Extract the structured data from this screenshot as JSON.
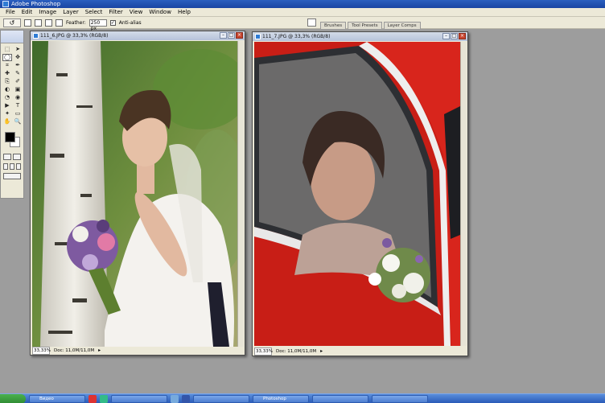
{
  "app": {
    "title": "Adobe Photoshop"
  },
  "menu": [
    "File",
    "Edit",
    "Image",
    "Layer",
    "Select",
    "Filter",
    "View",
    "Window",
    "Help"
  ],
  "options": {
    "feather_label": "Feather:",
    "feather_value": "250 px",
    "antialias_label": "Anti-alias",
    "antialias_checked": "✓"
  },
  "palette_tabs": [
    "Brushes",
    "Tool Presets",
    "Layer Comps"
  ],
  "tools": [
    "⬚",
    "➤",
    "◯",
    "✥",
    "⌗",
    "✒",
    "✚",
    "✎",
    "⎘",
    "✐",
    "◐",
    "▣",
    "◔",
    "◉",
    "▶",
    "T",
    "✦",
    "▭",
    "✋",
    "🔍"
  ],
  "documents": [
    {
      "title": "111_6.JPG @ 33,3% (RGB/8)",
      "zoom": "33,33%",
      "doc": "Doc: 11,0M/11,0M"
    },
    {
      "title": "111_7.JPG @ 33,3% (RGB/8)",
      "zoom": "33,33%",
      "doc": "Doc: 11,0M/11,0M"
    }
  ],
  "window_buttons": {
    "minimize": "–",
    "maximize": "□",
    "close": "×"
  },
  "taskbar": {
    "items": [
      "Видео",
      "",
      "Photoshop",
      "",
      "",
      "",
      "",
      "",
      "",
      ""
    ]
  },
  "colors": {
    "fg": "#000000",
    "bg": "#ffffff",
    "workspace": "#9d9d9d"
  }
}
